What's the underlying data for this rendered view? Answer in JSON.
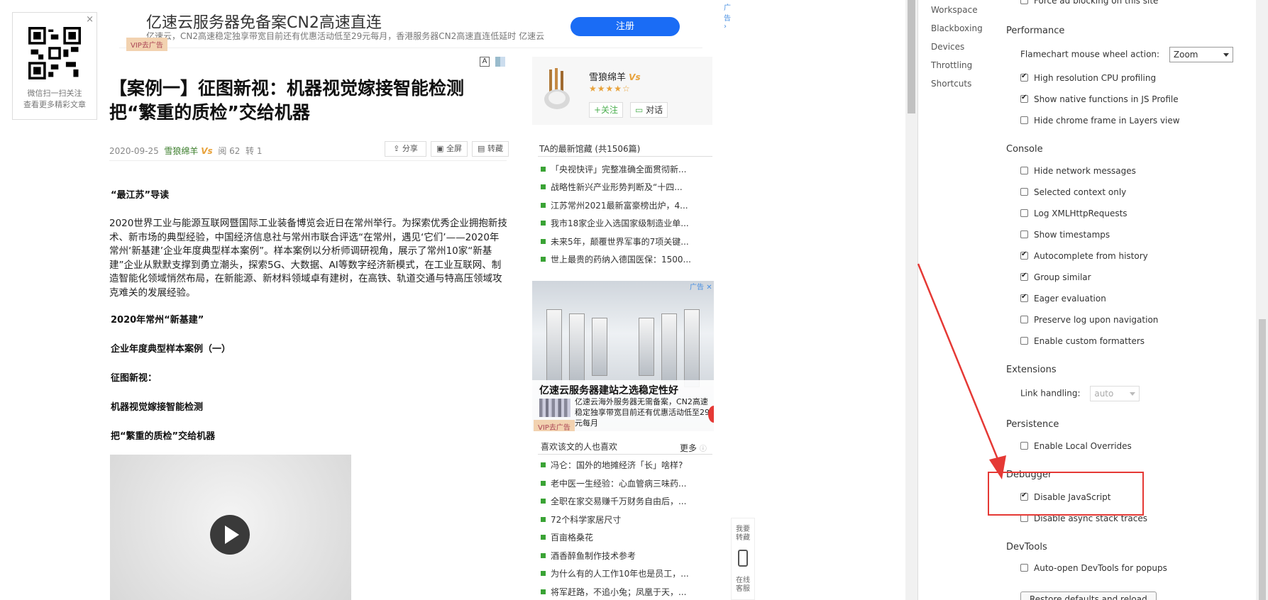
{
  "qr": {
    "close": "×",
    "line1": "微信扫一扫关注",
    "line2": "查看更多精彩文章"
  },
  "top_ad": {
    "title": "亿速云服务器免备案CN2高速直连",
    "desc": "亿速云，CN2高速稳定独享带宽目前还有优惠活动低至29元每月，香港服务器CN2高速直连低延时 亿速云",
    "button": "注册",
    "ad_label": "广告",
    "vip": "VIP去广告"
  },
  "font_ctl": "A",
  "article": {
    "title_line1": "【案例一】征图新视：机器视觉嫁接智能检测",
    "title_line2": "把“繁重的质检”交给机器",
    "date": "2020-09-25",
    "author": "雪狼绵羊",
    "author_badge": "Vs",
    "reads": "阅 62",
    "reposts": "转 1",
    "tool_share": "分享",
    "tool_fullscreen": "全屏",
    "tool_convert": "转藏",
    "intro_heading": "“最江苏”导读",
    "paragraph": "2020世界工业与能源互联网暨国际工业装备博览会近日在常州举行。为探索优秀企业拥抱新技术、新市场的典型经验，中国经济信息社与常州市联合评选“在常州，遇见‘它们’——2020年常州‘新基建’企业年度典型样本案例”。样本案例以分析师调研视角，展示了常州10家“新基建”企业从默默支撑到勇立潮头，探索5G、大数据、AI等数字经济新模式，在工业互联网、制造智能化领域悄然布局，在新能源、新材料领域卓有建树，在高铁、轨道交通与特高压领域攻克难关的发展经验。",
    "h1": "2020年常州“新基建”",
    "h2": "企业年度典型样本案例（一）",
    "h3": "征图新视：",
    "h4": "机器视觉嫁接智能检测",
    "h5": "把“繁重的质检”交给机器"
  },
  "profile": {
    "name": "雪狼绵羊",
    "badge": "Vs",
    "stars": "★★★★☆",
    "follow": "+关注",
    "chat": "对话"
  },
  "latest": {
    "title": "TA的最新馆藏 (共1506篇)",
    "items": [
      "「央视快评」完整准确全面贯彻新...",
      "战略性新兴产业形势判断及“十四...",
      "江苏常州2021最新富豪榜出炉，4...",
      "我市18家企业入选国家级制造业单...",
      "未来5年，颠覆世界军事的7项关键...",
      "世上最贵的药纳入德国医保：1500..."
    ]
  },
  "ad2": {
    "label": "广告",
    "title": "亿速云服务器建站之选稳定性好",
    "desc": "亿速云海外服务器无需备案，CN2高速稳定独享带宽目前还有优惠活动低至29元每月",
    "vip": "VIP去广告"
  },
  "liked": {
    "title": "喜欢该文的人也喜欢",
    "more": "更多",
    "items": [
      "冯仑：国外的地摊经济「长」啥样?",
      "老中医一生经验：心血管病三味药...",
      "全职在家交易赚千万财务自由后，...",
      "72个科学家居尺寸",
      "百亩格桑花",
      "酒香醉鱼制作技术参考",
      "为什么有的人工作10年也是员工，...",
      "将军赶路，不追小兔；凤凰于天，..."
    ]
  },
  "side_tools": {
    "t1": "我要转藏",
    "t2": "在线客服"
  },
  "devtools": {
    "nav": [
      "Workspace",
      "Blackboxing",
      "Devices",
      "Throttling",
      "Shortcuts"
    ],
    "top_partial": "Force ad blocking on this site",
    "performance": {
      "title": "Performance",
      "wheel_label": "Flamechart mouse wheel action:",
      "wheel_value": "Zoom",
      "opts": [
        {
          "label": "High resolution CPU profiling",
          "checked": true
        },
        {
          "label": "Show native functions in JS Profile",
          "checked": true
        },
        {
          "label": "Hide chrome frame in Layers view",
          "checked": false
        }
      ]
    },
    "console": {
      "title": "Console",
      "opts": [
        {
          "label": "Hide network messages",
          "checked": false
        },
        {
          "label": "Selected context only",
          "checked": false
        },
        {
          "label": "Log XMLHttpRequests",
          "checked": false
        },
        {
          "label": "Show timestamps",
          "checked": false
        },
        {
          "label": "Autocomplete from history",
          "checked": true
        },
        {
          "label": "Group similar",
          "checked": true
        },
        {
          "label": "Eager evaluation",
          "checked": true
        },
        {
          "label": "Preserve log upon navigation",
          "checked": false
        },
        {
          "label": "Enable custom formatters",
          "checked": false
        }
      ]
    },
    "extensions": {
      "title": "Extensions",
      "link_label": "Link handling:",
      "link_value": "auto"
    },
    "persistence": {
      "title": "Persistence",
      "opt": "Enable Local Overrides"
    },
    "debugger": {
      "title": "Debugger",
      "opts": [
        {
          "label": "Disable JavaScript",
          "checked": true
        },
        {
          "label": "Disable async stack traces",
          "checked": false
        }
      ]
    },
    "devtools_sec": {
      "title": "DevTools",
      "opt": "Auto-open DevTools for popups"
    },
    "restore": "Restore defaults and reload"
  },
  "colors": {
    "highlight": "#e53935",
    "accent_blue": "#1a6cf5",
    "green": "#3aa335"
  }
}
